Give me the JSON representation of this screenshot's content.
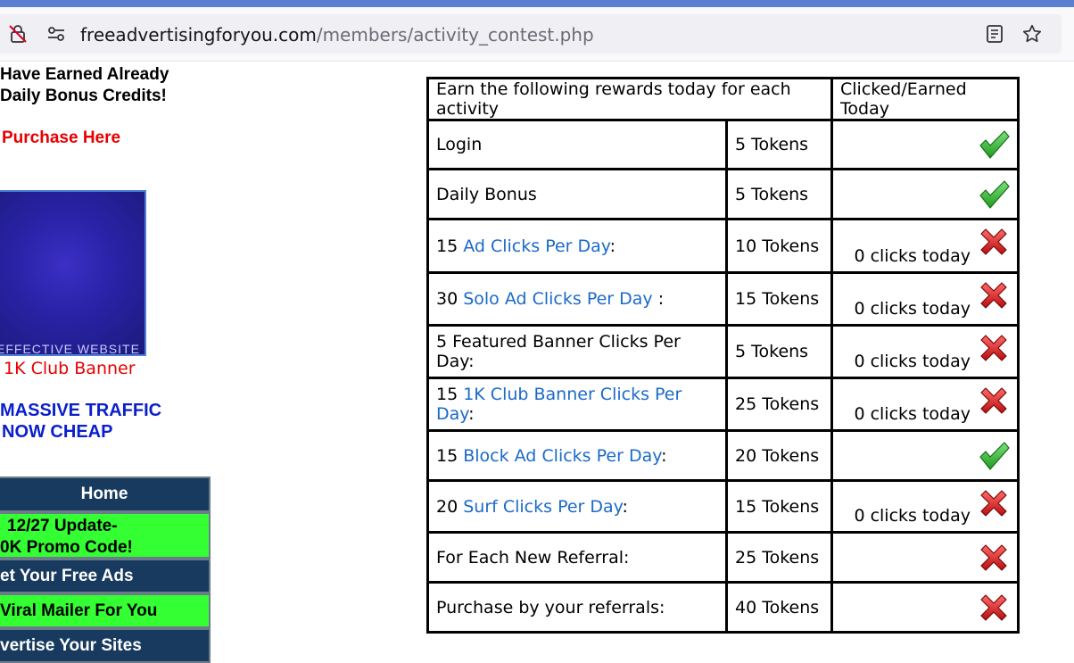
{
  "browser": {
    "url_domain": "freeadvertisingforyou.com",
    "url_path": "/members/activity_contest.php"
  },
  "sidebar": {
    "earned_line1": "Have Earned Already",
    "earned_line2": "Daily Bonus Credits!",
    "purchase_link": "Purchase Here",
    "banner_text": "EFFECTIVE WEBSITE",
    "banner_caption": "1K Club Banner",
    "promo_line1": "MASSIVE TRAFFIC",
    "promo_line2": "NOW CHEAP",
    "menu": [
      {
        "label": "Home"
      },
      {
        "label_line1": "12/27 Update-",
        "label_line2": "0K Promo Code!"
      },
      {
        "label": "et Your Free Ads"
      },
      {
        "label": "Viral Mailer For You"
      },
      {
        "label": "vertise Your Sites"
      }
    ]
  },
  "rewards": {
    "header_activity": "Earn the following rewards today for each activity",
    "header_status": "Clicked/Earned Today",
    "rows": [
      {
        "prefix": "Login",
        "link": "",
        "suffix": "",
        "tokens": "5 Tokens",
        "clicks": "",
        "status": "check"
      },
      {
        "prefix": "Daily Bonus",
        "link": "",
        "suffix": "",
        "tokens": "5 Tokens",
        "clicks": "",
        "status": "check"
      },
      {
        "prefix": "15 ",
        "link": "Ad Clicks Per Day",
        "suffix": ":",
        "tokens": "10 Tokens",
        "clicks": "0 clicks today",
        "status": "cross"
      },
      {
        "prefix": "30 ",
        "link": "Solo Ad Clicks Per Day",
        "suffix": " :",
        "tokens": "15 Tokens",
        "clicks": "0 clicks today",
        "status": "cross"
      },
      {
        "prefix": "5 Featured Banner Clicks Per Day:",
        "link": "",
        "suffix": "",
        "tokens": "5 Tokens",
        "clicks": "0 clicks today",
        "status": "cross"
      },
      {
        "prefix": "15 ",
        "link": "1K Club Banner Clicks Per Day",
        "suffix": ":",
        "tokens": "25 Tokens",
        "clicks": "0 clicks today",
        "status": "cross"
      },
      {
        "prefix": "15 ",
        "link": "Block Ad Clicks Per Day",
        "suffix": ":",
        "tokens": "20 Tokens",
        "clicks": "",
        "status": "check"
      },
      {
        "prefix": "20 ",
        "link": "Surf Clicks Per Day",
        "suffix": ":",
        "tokens": "15 Tokens",
        "clicks": "0 clicks today",
        "status": "cross"
      },
      {
        "prefix": "For Each New Referral:",
        "link": "",
        "suffix": "",
        "tokens": "25 Tokens",
        "clicks": "",
        "status": "cross"
      },
      {
        "prefix": "Purchase by your referrals:",
        "link": "",
        "suffix": "",
        "tokens": "40 Tokens",
        "clicks": "",
        "status": "cross"
      }
    ]
  },
  "colors": {
    "link_blue": "#1a6ac9",
    "check_green": "#2fbf2f",
    "cross_red": "#d42020",
    "menu_dark": "#173a5e",
    "menu_green": "#33ff33"
  }
}
